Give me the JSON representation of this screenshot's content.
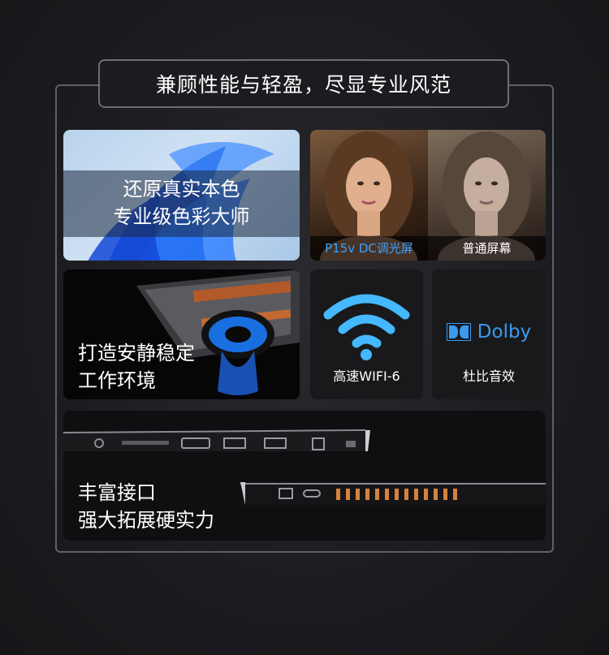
{
  "header": {
    "title": "兼顾性能与轻盈，尽显专业风范"
  },
  "cards": {
    "color": {
      "line1": "还原真实本色",
      "line2": "专业级色彩大师"
    },
    "screen": {
      "left_label": "P15v DC调光屏",
      "right_label": "普通屏幕"
    },
    "cooling": {
      "line1": "打造安静稳定",
      "line2": "工作环境"
    },
    "wifi": {
      "label": "高速WIFI-6",
      "icon": "wifi-icon"
    },
    "dolby": {
      "logo_text": "Dolby",
      "label": "杜比音效",
      "icon": "dolby-icon"
    },
    "ports": {
      "line1": "丰富接口",
      "line2": "强大拓展硬实力"
    }
  },
  "colors": {
    "accent_blue": "#3aa2ff",
    "background": "#1d1d21"
  }
}
